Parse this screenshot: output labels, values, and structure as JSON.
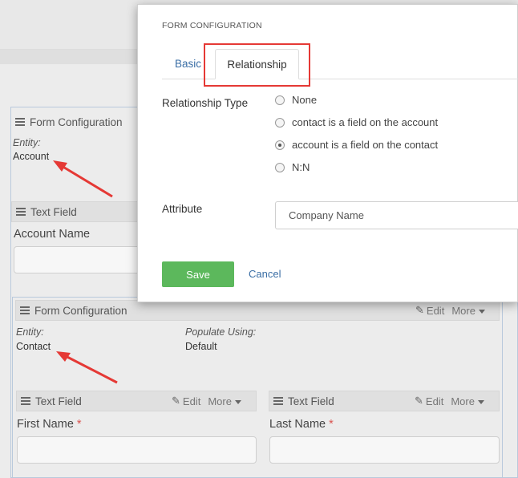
{
  "background": {
    "form_config_1": {
      "title": "Form Configuration",
      "entity_label": "Entity:",
      "entity_value": "Account"
    },
    "text_field_1": {
      "title": "Text Field",
      "field_label": "Account Name"
    },
    "form_config_2": {
      "title": "Form Configuration",
      "edit_label": "Edit",
      "more_label": "More",
      "entity_label": "Entity:",
      "entity_value": "Contact",
      "populate_label": "Populate Using:",
      "populate_value": "Default"
    },
    "text_field_first": {
      "title": "Text Field",
      "edit_label": "Edit",
      "more_label": "More",
      "field_label": "First Name",
      "required": "*"
    },
    "text_field_last": {
      "title": "Text Field",
      "edit_label": "Edit",
      "more_label": "More",
      "field_label": "Last Name",
      "required": "*"
    }
  },
  "modal": {
    "title": "FORM CONFIGURATION",
    "tabs": [
      {
        "label": "Basic"
      },
      {
        "label": "Relationship"
      }
    ],
    "relationship_type_label": "Relationship Type",
    "options": [
      {
        "label": "None",
        "checked": false
      },
      {
        "label": "contact is a field on the account",
        "checked": false
      },
      {
        "label": "account is a field on the contact",
        "checked": true
      },
      {
        "label": "N:N",
        "checked": false
      }
    ],
    "attribute_label": "Attribute",
    "attribute_value": "Company Name",
    "save_label": "Save",
    "cancel_label": "Cancel"
  },
  "colors": {
    "accent_green": "#5cb85c",
    "link_blue": "#3a6ea5",
    "annotation_red": "#e53935"
  }
}
